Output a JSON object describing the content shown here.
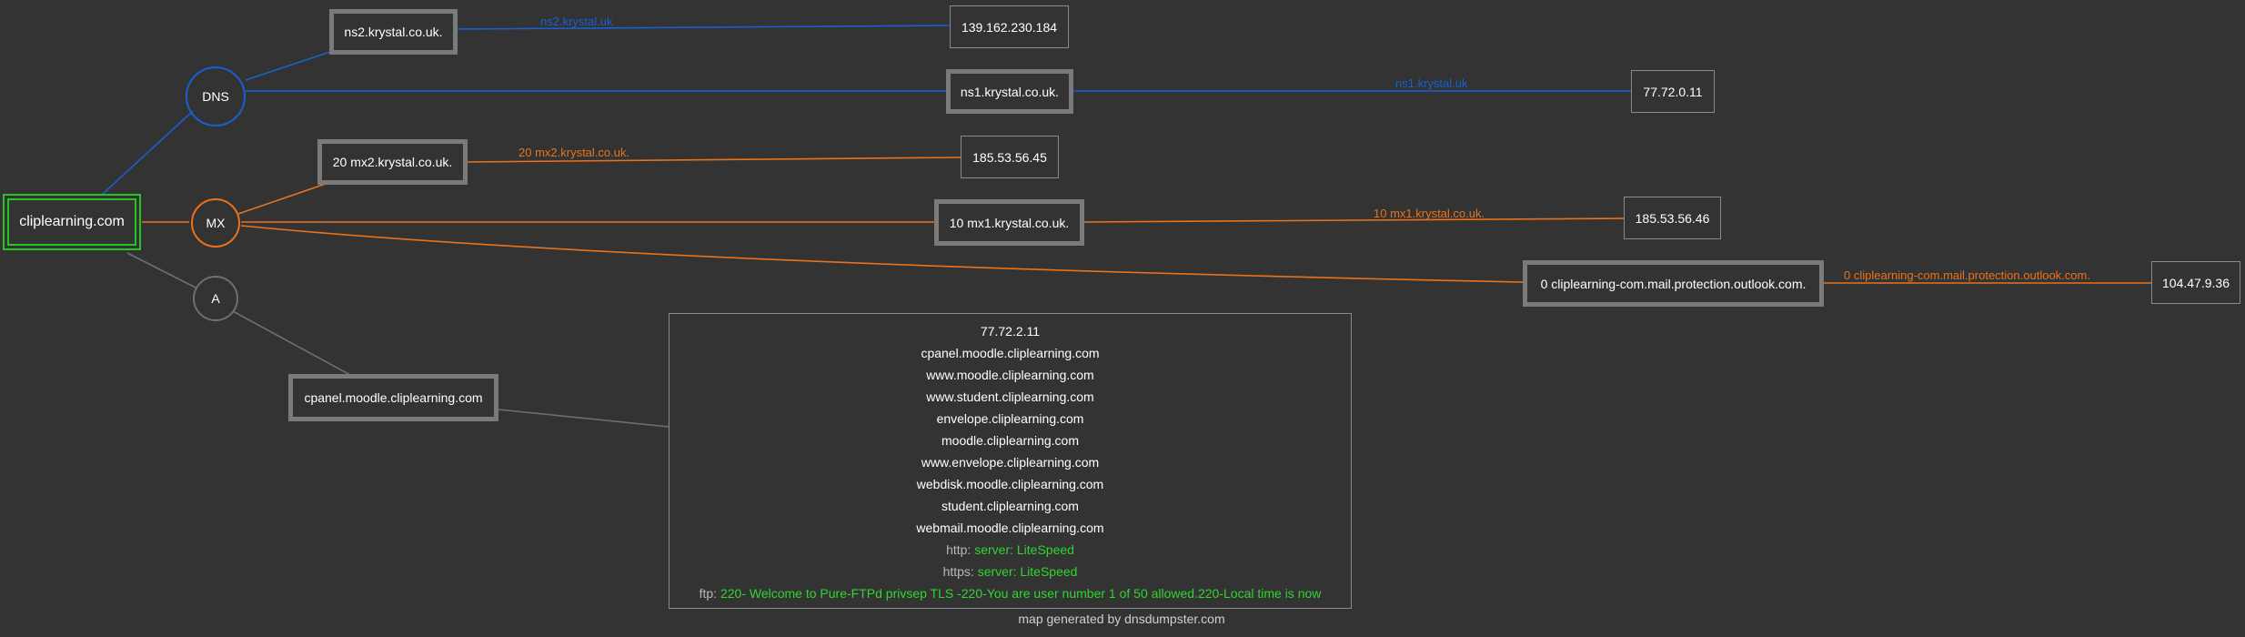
{
  "colors": {
    "background": "#333333",
    "dns_edge": "#1a5fd1",
    "mx_edge": "#e8731c",
    "a_edge": "#6f6f6f",
    "root_border": "#25c425",
    "service_value": "#2fd62f"
  },
  "root": {
    "label": "cliplearning.com"
  },
  "groups": {
    "dns": "DNS",
    "mx": "MX",
    "a": "A"
  },
  "dns_records": [
    {
      "host": "ns2.krystal.co.uk.",
      "edge_label": "ns2.krystal.uk",
      "ip": "139.162.230.184"
    },
    {
      "host": "ns1.krystal.co.uk.",
      "edge_label": "ns1.krystal.uk",
      "ip": "77.72.0.11"
    }
  ],
  "mx_records": [
    {
      "host": "20 mx2.krystal.co.uk.",
      "edge_label": "20 mx2.krystal.co.uk.",
      "ip": "185.53.56.45"
    },
    {
      "host": "10 mx1.krystal.co.uk.",
      "edge_label": "10 mx1.krystal.co.uk.",
      "ip": "185.53.56.46"
    },
    {
      "host": "0 cliplearning-com.mail.protection.outlook.com.",
      "edge_label": "0 cliplearning-com.mail.protection.outlook.com.",
      "ip": "104.47.9.36"
    }
  ],
  "a_record": {
    "host": "cpanel.moodle.cliplearning.com",
    "ip": "77.72.2.11",
    "hostnames": [
      "cpanel.moodle.cliplearning.com",
      "www.moodle.cliplearning.com",
      "www.student.cliplearning.com",
      "envelope.cliplearning.com",
      "moodle.cliplearning.com",
      "www.envelope.cliplearning.com",
      "webdisk.moodle.cliplearning.com",
      "student.cliplearning.com",
      "webmail.moodle.cliplearning.com"
    ],
    "services": [
      {
        "label": "http:",
        "value": "server: LiteSpeed"
      },
      {
        "label": "https:",
        "value": "server: LiteSpeed"
      },
      {
        "label": "ftp:",
        "value": "220- Welcome to Pure-FTPd privsep TLS -220-You are user number 1 of 50 allowed.220-Local time is now"
      }
    ]
  },
  "footer": "map generated by dnsdumpster.com"
}
